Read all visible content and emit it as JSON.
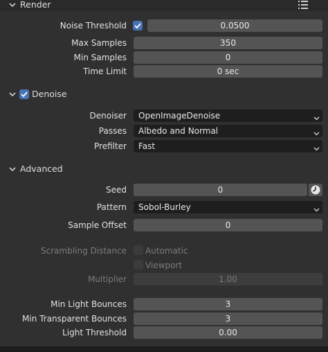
{
  "render": {
    "title": "Render",
    "noise_threshold_label": "Noise Threshold",
    "noise_threshold_enabled": true,
    "noise_threshold_value": "0.0500",
    "max_samples_label": "Max Samples",
    "max_samples_value": "350",
    "min_samples_label": "Min Samples",
    "min_samples_value": "0",
    "time_limit_label": "Time Limit",
    "time_limit_value": "0 sec"
  },
  "denoise": {
    "title": "Denoise",
    "enabled": true,
    "denoiser_label": "Denoiser",
    "denoiser_value": "OpenImageDenoise",
    "passes_label": "Passes",
    "passes_value": "Albedo and Normal",
    "prefilter_label": "Prefilter",
    "prefilter_value": "Fast"
  },
  "advanced": {
    "title": "Advanced",
    "seed_label": "Seed",
    "seed_value": "0",
    "pattern_label": "Pattern",
    "pattern_value": "Sobol-Burley",
    "sample_offset_label": "Sample Offset",
    "sample_offset_value": "0",
    "scrambling_distance_label": "Scrambling Distance",
    "automatic_label": "Automatic",
    "viewport_label": "Viewport",
    "multiplier_label": "Multiplier",
    "multiplier_value": "1.00",
    "min_light_bounces_label": "Min Light Bounces",
    "min_light_bounces_value": "3",
    "min_transparent_bounces_label": "Min Transparent Bounces",
    "min_transparent_bounces_value": "3",
    "light_threshold_label": "Light Threshold",
    "light_threshold_value": "0.00"
  },
  "colors": {
    "accent": "#4772b3",
    "background": "#303030",
    "field": "#545454",
    "dropdown": "#1e1e1e"
  }
}
